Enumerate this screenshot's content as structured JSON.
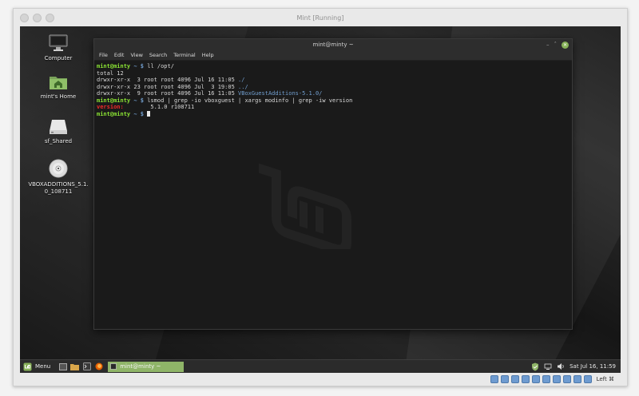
{
  "host": {
    "title": "Mint [Running]"
  },
  "desktop": {
    "icons": [
      {
        "name": "computer",
        "label": "Computer"
      },
      {
        "name": "home",
        "label": "mint's Home"
      },
      {
        "name": "share",
        "label": "sf_Shared"
      },
      {
        "name": "disc",
        "label_line1": "VBOXADDITIONS_5.1.",
        "label_line2": "0_108711"
      }
    ]
  },
  "terminal": {
    "title": "mint@minty ~",
    "menu": [
      "File",
      "Edit",
      "View",
      "Search",
      "Terminal",
      "Help"
    ],
    "lines": {
      "l1": {
        "prompt": "mint@minty",
        "path": " ~ $",
        "cmd": " ll /opt/"
      },
      "l2": "total 12",
      "l3": {
        "text": "drwxr-xr-x  3 root root 4096 Jul 16 11:05 ",
        "dir": "./"
      },
      "l4": {
        "text": "drwxr-xr-x 23 root root 4096 Jul  3 19:05 ",
        "dir": "../"
      },
      "l5": {
        "text": "drwxr-xr-x  9 root root 4096 Jul 16 11:05 ",
        "dir": "VBoxGuestAdditions-5.1.0/"
      },
      "l6": {
        "prompt": "mint@minty",
        "path": " ~ $",
        "cmd": " lsmod | grep -io vboxguest | xargs modinfo | grep -iw version"
      },
      "l7": {
        "key": "version:",
        "value": "        5.1.0 r108711"
      },
      "l8": {
        "prompt": "mint@minty",
        "path": " ~ $",
        "cmd": " "
      }
    }
  },
  "taskbar": {
    "menu_label": "Menu",
    "task_label": "mint@minty ~",
    "clock": "Sat Jul 16, 11:59"
  },
  "statusbar": {
    "host_key": "Left ⌘"
  },
  "colors": {
    "prompt": "#8ae234",
    "path": "#729fcf",
    "version_key": "#ef2929",
    "task_green": "#8fb568"
  }
}
